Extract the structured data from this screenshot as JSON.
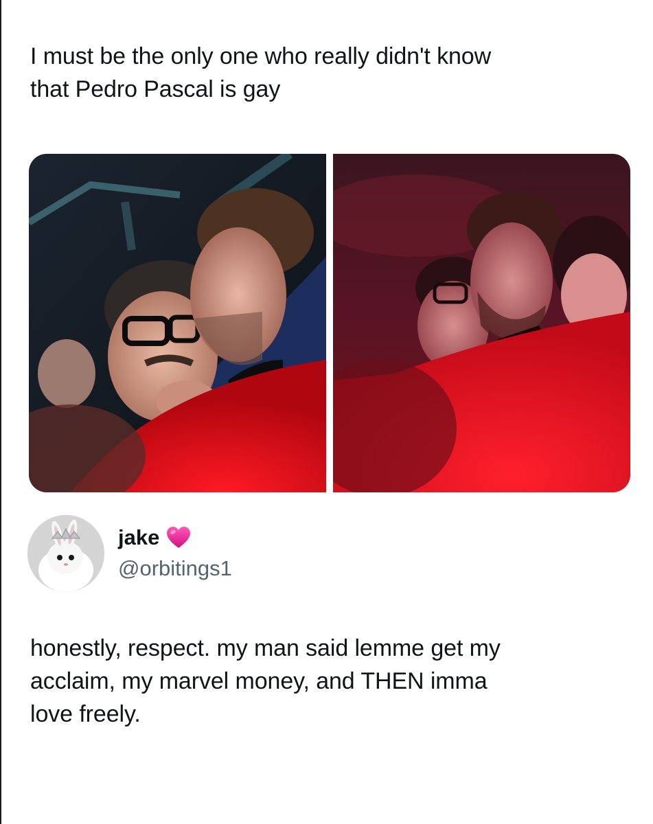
{
  "post": {
    "caption": "I must be the only one who really didn't know\nthat Pedro Pascal is gay"
  },
  "media": {
    "photos": [
      {
        "alt": ""
      },
      {
        "alt": ""
      }
    ]
  },
  "tweet": {
    "author": {
      "display_name": "jake",
      "badge_icon": "pink-heart-icon",
      "handle": "@orbitings1",
      "avatar_icon": "bunny-avatar"
    },
    "body": "honestly, respect. my man said lemme get my\nacclaim, my marvel money, and THEN imma\nlove freely."
  },
  "colors": {
    "text": "#0f1419",
    "secondary_text": "#536471",
    "heart": "#e0158c",
    "accent_red": "#e0101e"
  }
}
